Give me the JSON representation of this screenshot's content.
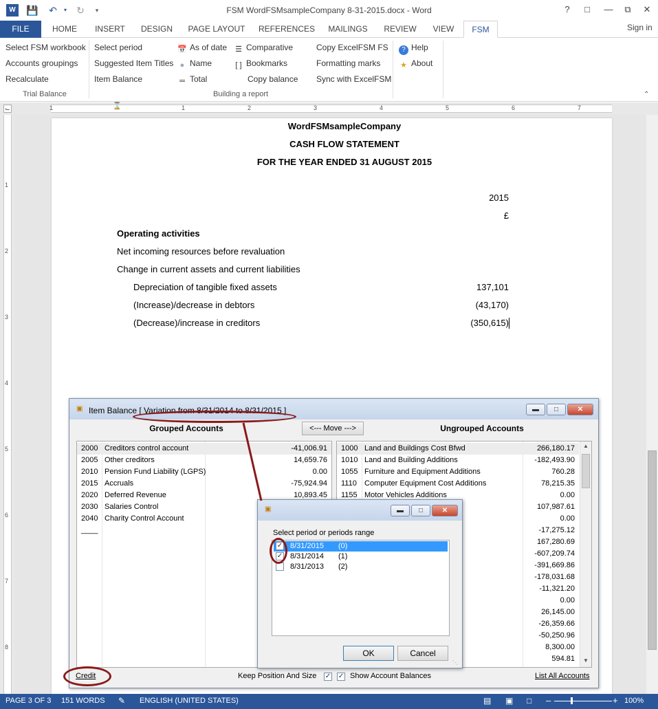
{
  "window": {
    "title": "FSM WordFSMsampleCompany 8-31-2015.docx - Word",
    "signin": "Sign in"
  },
  "tabs": [
    "FILE",
    "HOME",
    "INSERT",
    "DESIGN",
    "PAGE LAYOUT",
    "REFERENCES",
    "MAILINGS",
    "REVIEW",
    "VIEW",
    "FSM"
  ],
  "ribbon": {
    "trial": [
      "Select FSM workbook",
      "Accounts groupings",
      "Recalculate"
    ],
    "trial_label": "Trial Balance",
    "col2": [
      "Select period",
      "Suggested Item Titles",
      "Item Balance"
    ],
    "col3": [
      "As of date",
      "Name",
      "Total"
    ],
    "col4": [
      "Comparative",
      "Bookmarks",
      "Copy balance"
    ],
    "col5": [
      "Copy ExcelFSM FS",
      "Formatting marks",
      "Sync with ExcelFSM"
    ],
    "build_label": "Building a report",
    "help": [
      "Help",
      "About"
    ]
  },
  "document": {
    "company": "WordFSMsampleCompany",
    "statement": "CASH FLOW STATEMENT",
    "period": "FOR THE YEAR ENDED 31 AUGUST 2015",
    "year": "2015",
    "currency": "£",
    "section": "Operating activities",
    "lines": [
      "Net incoming resources before revaluation",
      "Change in current assets and current liabilities"
    ],
    "items": [
      {
        "label": "Depreciation of tangible fixed assets",
        "value": "137,101"
      },
      {
        "label": "(Increase)/decrease in debtors",
        "value": "(43,170)"
      },
      {
        "label": "(Decrease)/increase in creditors",
        "value": "(350,615)"
      }
    ]
  },
  "status": {
    "page": "PAGE 3 OF 3",
    "words": "151 WORDS",
    "language": "ENGLISH (UNITED STATES)",
    "zoom": "100%"
  },
  "dialog": {
    "title": "Item Balance [ Variation from  8/31/2014  to  8/31/2015 ]",
    "grouped_header": "Grouped Accounts",
    "ungrouped_header": "Ungrouped Accounts",
    "move_label": "<--- Move --->",
    "grouped": [
      {
        "code": "2000",
        "name": "Creditors control account",
        "value": "-41,006.91"
      },
      {
        "code": "2005",
        "name": "Other creditors",
        "value": "14,659.76"
      },
      {
        "code": "2010",
        "name": "Pension Fund Liability (LGPS)",
        "value": "0.00"
      },
      {
        "code": "2015",
        "name": "Accruals",
        "value": "-75,924.94"
      },
      {
        "code": "2020",
        "name": "Deferred Revenue",
        "value": "10,893.45"
      },
      {
        "code": "2030",
        "name": "Salaries Control",
        "value": ""
      },
      {
        "code": "2040",
        "name": "Charity Control Account",
        "value": ""
      },
      {
        "code": "____",
        "name": "",
        "value": ""
      }
    ],
    "ungrouped": [
      {
        "code": "1000",
        "name": "Land and Buildings Cost Bfwd",
        "value": "266,180.17"
      },
      {
        "code": "1010",
        "name": "Land and Building Additions",
        "value": "-182,493.90"
      },
      {
        "code": "1055",
        "name": "Furniture and Equipment Additions",
        "value": "760.28"
      },
      {
        "code": "1110",
        "name": "Computer Equipment Cost Additions",
        "value": "78,215.35"
      },
      {
        "code": "1155",
        "name": "Motor Vehicles Additions",
        "value": "0.00"
      },
      {
        "code": "",
        "name": "",
        "value": "107,987.61"
      },
      {
        "code": "",
        "name": "",
        "value": "0.00"
      },
      {
        "code": "",
        "name": "",
        "value": "-17,275.12"
      },
      {
        "code": "",
        "name": "",
        "value": "167,280.69"
      },
      {
        "code": "",
        "name": "",
        "value": "-607,209.74"
      },
      {
        "code": "",
        "name": "",
        "value": "-391,669.86"
      },
      {
        "code": "",
        "name": "",
        "value": "-178,031.68"
      },
      {
        "code": "",
        "name": "nt",
        "value": "-11,321.20"
      },
      {
        "code": "",
        "name": "",
        "value": "0.00"
      },
      {
        "code": "",
        "name": "aic",
        "value": "26,145.00"
      },
      {
        "code": "",
        "name": "",
        "value": "-26,359.66"
      },
      {
        "code": "",
        "name": "",
        "value": "-50,250.96"
      },
      {
        "code": "",
        "name": "eceived",
        "value": "8,300.00"
      },
      {
        "code": "",
        "name": "ent",
        "value": "594.81"
      }
    ],
    "credit": "Credit",
    "keep_position": "Keep Position And Size",
    "show_balances": "Show Account Balances",
    "list_all": "List All Accounts"
  },
  "period_dialog": {
    "prompt": "Select period or periods range",
    "periods": [
      {
        "date": "8/31/2015",
        "idx": "(0)",
        "checked": true,
        "selected": true
      },
      {
        "date": "8/31/2014",
        "idx": "(1)",
        "checked": true,
        "selected": false
      },
      {
        "date": "8/31/2013",
        "idx": "(2)",
        "checked": false,
        "selected": false
      }
    ],
    "ok": "OK",
    "cancel": "Cancel"
  }
}
